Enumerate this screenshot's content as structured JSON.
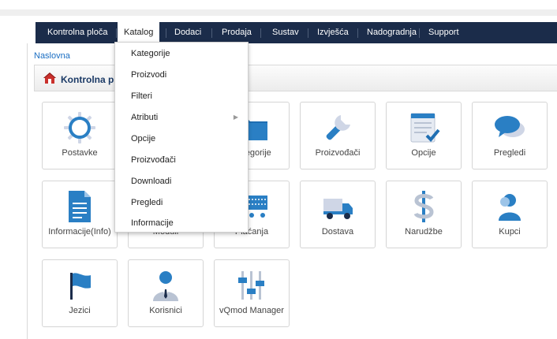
{
  "nav": {
    "items": [
      {
        "label": "Kontrolna ploča"
      },
      {
        "label": "Katalog"
      },
      {
        "label": "Dodaci"
      },
      {
        "label": "Prodaja"
      },
      {
        "label": "Sustav"
      },
      {
        "label": "Izvješća"
      },
      {
        "label": "Nadogradnja"
      },
      {
        "label": "Support"
      }
    ]
  },
  "breadcrumb": "Naslovna",
  "panel": {
    "title": "Kontrolna ploča"
  },
  "tiles": [
    {
      "label": "Postavke",
      "icon": "gear-icon"
    },
    {
      "label": "Kategorije",
      "icon": "folder-icon"
    },
    {
      "label": "Proizvođači",
      "icon": "wrench-icon"
    },
    {
      "label": "Opcije",
      "icon": "checklist-icon"
    },
    {
      "label": "Pregledi",
      "icon": "speech-bubble-icon"
    },
    {
      "label": "Informacije(Info)",
      "icon": "document-icon"
    },
    {
      "label": "Moduli",
      "icon": "puzzle-icon"
    },
    {
      "label": "Plaćanja",
      "icon": "cart-icon"
    },
    {
      "label": "Dostava",
      "icon": "truck-icon"
    },
    {
      "label": "Narudžbe",
      "icon": "dollar-icon"
    },
    {
      "label": "Kupci",
      "icon": "user-icon"
    },
    {
      "label": "Jezici",
      "icon": "flag-icon"
    },
    {
      "label": "Korisnici",
      "icon": "businessman-icon"
    },
    {
      "label": "vQmod Manager",
      "icon": "sliders-icon"
    }
  ],
  "dropdown": {
    "items": [
      {
        "label": "Kategorije"
      },
      {
        "label": "Proizvodi"
      },
      {
        "label": "Filteri"
      },
      {
        "label": "Atributi",
        "has_submenu": true
      },
      {
        "label": "Opcije"
      },
      {
        "label": "Proizvođači"
      },
      {
        "label": "Downloadi"
      },
      {
        "label": "Pregledi"
      },
      {
        "label": "Informacije"
      }
    ]
  },
  "colors": {
    "navbar": "#1b2c4a",
    "icon_blue": "#2a7fc4",
    "link": "#1a6ec3"
  }
}
